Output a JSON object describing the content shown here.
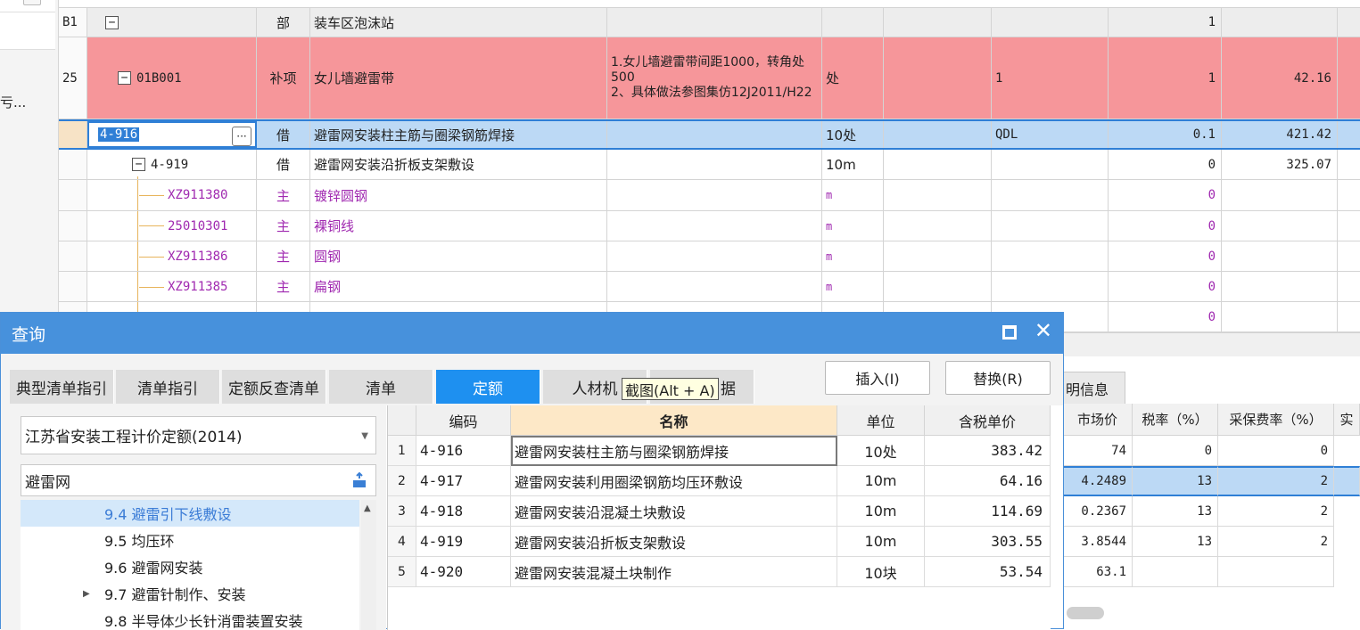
{
  "left_stub": {
    "truncated_label": "亏..."
  },
  "top_grid": {
    "rows": [
      {
        "seq": "B1",
        "code": "",
        "category": "部",
        "name": "装车区泡沫站",
        "feature": "",
        "unit": "",
        "qty_expr": "",
        "qty": "1",
        "price": ""
      },
      {
        "seq": "25",
        "code": "01B001",
        "category": "补项",
        "name": "女儿墙避雷带",
        "feature": "1.女儿墙避雷带间距1000，转角处500\n2、具体做法参图集仿12J2011/H22",
        "unit": "处",
        "qty_expr": "1",
        "qty": "1",
        "price": "42.16"
      },
      {
        "seq": "",
        "code": "4-916",
        "category": "借",
        "name": "避雷网安装柱主筋与圈梁钢筋焊接",
        "feature": "",
        "unit": "10处",
        "qty_expr": "QDL",
        "qty": "0.1",
        "price": "421.42"
      },
      {
        "seq": "",
        "code": "4-919",
        "category": "借",
        "name": "避雷网安装沿折板支架敷设",
        "feature": "",
        "unit": "10m",
        "qty_expr": "",
        "qty": "0",
        "price": "325.07"
      },
      {
        "seq": "",
        "code": "XZ911380",
        "category": "主",
        "name": "镀锌圆钢",
        "feature": "",
        "unit": "m",
        "qty_expr": "",
        "qty": "0",
        "price": ""
      },
      {
        "seq": "",
        "code": "25010301",
        "category": "主",
        "name": "裸铜线",
        "feature": "",
        "unit": "m",
        "qty_expr": "",
        "qty": "0",
        "price": ""
      },
      {
        "seq": "",
        "code": "XZ911386",
        "category": "主",
        "name": "圆钢",
        "feature": "",
        "unit": "m",
        "qty_expr": "",
        "qty": "0",
        "price": ""
      },
      {
        "seq": "",
        "code": "XZ911385",
        "category": "主",
        "name": "扁钢",
        "feature": "",
        "unit": "m",
        "qty_expr": "",
        "qty": "0",
        "price": ""
      },
      {
        "seq": "",
        "code": "",
        "category": "",
        "name": "",
        "feature": "",
        "unit": "",
        "qty_expr": "",
        "qty": "0",
        "price": ""
      }
    ]
  },
  "right_panel": {
    "tab_label": "明信息",
    "headers": [
      "市场价",
      "税率（%）",
      "采保费率（%）",
      "实"
    ],
    "rows": [
      [
        "74",
        "0",
        "0"
      ],
      [
        "4.2489",
        "13",
        "2"
      ],
      [
        "0.2367",
        "13",
        "2"
      ],
      [
        "3.8544",
        "13",
        "2"
      ],
      [
        "63.1",
        "",
        ""
      ]
    ]
  },
  "dialog": {
    "title": "查询",
    "tabs": [
      "典型清单指引",
      "清单指引",
      "定额反查清单",
      "清单",
      "定额",
      "人材机",
      "据"
    ],
    "active_tab": "定额",
    "insert_label": "插入(I)",
    "replace_label": "替换(R)",
    "tooltip": "截图(Alt + A)",
    "library": "江苏省安装工程计价定额(2014)",
    "search_value": "避雷网",
    "tree": [
      "9.4 避雷引下线敷设",
      "9.5 均压环",
      "9.6 避雷网安装",
      "9.7 避雷针制作、安装",
      "9.8 半导体少长针消雷装置安装"
    ],
    "grid": {
      "headers": {
        "code": "编码",
        "name": "名称",
        "unit": "单位",
        "price": "含税单价"
      },
      "rows": [
        {
          "idx": "1",
          "code": "4-916",
          "name": "避雷网安装柱主筋与圈梁钢筋焊接",
          "unit": "10处",
          "price": "383.42"
        },
        {
          "idx": "2",
          "code": "4-917",
          "name": "避雷网安装利用圈梁钢筋均压环敷设",
          "unit": "10m",
          "price": "64.16"
        },
        {
          "idx": "3",
          "code": "4-918",
          "name": "避雷网安装沿混凝土块敷设",
          "unit": "10m",
          "price": "114.69"
        },
        {
          "idx": "4",
          "code": "4-919",
          "name": "避雷网安装沿折板支架敷设",
          "unit": "10m",
          "price": "303.55"
        },
        {
          "idx": "5",
          "code": "4-920",
          "name": "避雷网安装混凝土块制作",
          "unit": "10块",
          "price": "53.54"
        }
      ]
    }
  }
}
